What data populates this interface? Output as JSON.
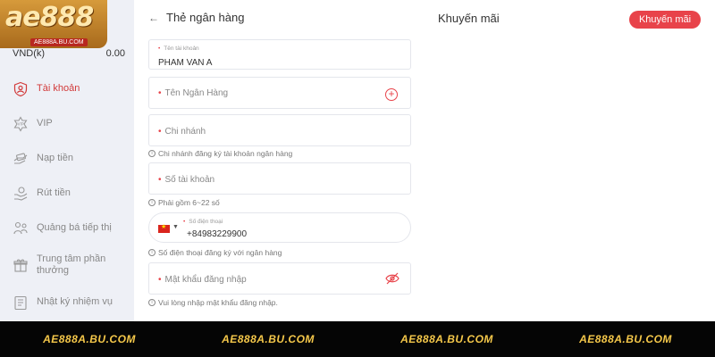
{
  "logo": {
    "main": "ae888",
    "sub": "AE888A.BU.COM"
  },
  "balance": {
    "currency": "VND(k)",
    "amount": "0.00"
  },
  "nav": [
    {
      "label": "Tài khoản",
      "icon": "user-shield-icon"
    },
    {
      "label": "VIP",
      "icon": "vip-badge-icon"
    },
    {
      "label": "Nạp tiền",
      "icon": "deposit-icon"
    },
    {
      "label": "Rút tiền",
      "icon": "withdraw-icon"
    },
    {
      "label": "Quảng bá tiếp thị",
      "icon": "promotion-share-icon"
    },
    {
      "label": "Trung tâm phần thưởng",
      "icon": "gift-icon"
    },
    {
      "label": "Nhật ký nhiệm vụ",
      "icon": "task-log-icon"
    }
  ],
  "header": {
    "back_label": "Thẻ ngân hàng",
    "promo_title": "Khuyến mãi",
    "promo_button": "Khuyến mãi"
  },
  "form": {
    "account_name": {
      "label": "Tên tài khoản",
      "value": "PHAM VAN A"
    },
    "bank_name": {
      "placeholder": "Tên Ngân Hàng"
    },
    "branch": {
      "placeholder": "Chi nhánh",
      "hint": "Chi nhánh đăng ký tài khoản ngân hàng"
    },
    "account_number": {
      "placeholder": "Số tài khoản",
      "hint": "Phải gồm 6~22 số"
    },
    "phone": {
      "label": "Số điện thoại",
      "value": "+84983229900",
      "hint": "Số điện thoại đăng ký với ngân hàng"
    },
    "password": {
      "placeholder": "Mật khẩu đăng nhập",
      "hint": "Vui lòng nhập mật khẩu đăng nhập."
    }
  },
  "footer": [
    "AE888A.BU.COM",
    "AE888A.BU.COM",
    "AE888A.BU.COM",
    "AE888A.BU.COM"
  ],
  "colors": {
    "accent": "#e8434a",
    "sidebar_bg": "#eef0f6",
    "footer_text": "#f5c84a"
  }
}
